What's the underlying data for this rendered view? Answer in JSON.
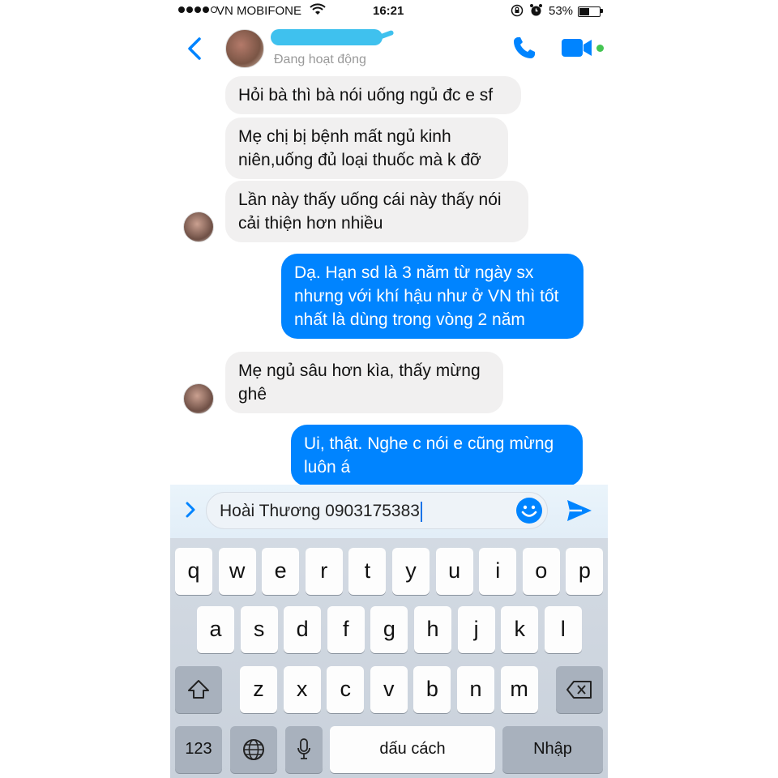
{
  "status_bar": {
    "carrier": "VN MOBIFONE",
    "time": "16:21",
    "battery_percent": "53%",
    "battery_level": 0.53,
    "signal_bars_filled": 4,
    "signal_bars_total": 5
  },
  "header": {
    "active_status": "Đang hoạt động",
    "name_obscured": true,
    "accent_color": "#0084ff"
  },
  "messages": [
    {
      "direction": "in",
      "text_lines": [
        "Hỏi bà thì bà nói uống ngủ đc e sf"
      ]
    },
    {
      "direction": "in",
      "text_lines": [
        "Mẹ chị bị bệnh mất ngủ kinh",
        "niên,uống đủ loại thuốc mà k đỡ"
      ]
    },
    {
      "direction": "in",
      "text_lines": [
        "Lần này thấy uống cái này thấy nói",
        "cải thiện hơn nhiều"
      ],
      "show_avatar": true
    },
    {
      "direction": "out",
      "text_lines": [
        "Dạ. Hạn sd là 3 năm từ ngày sx",
        "nhưng với khí hậu như ở VN thì tốt",
        "nhất là dùng trong vòng 2 năm"
      ]
    },
    {
      "direction": "in",
      "text_lines": [
        "Mẹ ngủ sâu hơn kìa, thấy mừng",
        "ghê"
      ],
      "show_avatar": true
    },
    {
      "direction": "out",
      "text_lines": [
        "Ui, thật. Nghe c nói e cũng mừng",
        "luôn á"
      ]
    }
  ],
  "composer": {
    "input_value": "Hoài Thương 0903175383"
  },
  "keyboard": {
    "row1": [
      "q",
      "w",
      "e",
      "r",
      "t",
      "y",
      "u",
      "i",
      "o",
      "p"
    ],
    "row2": [
      "a",
      "s",
      "d",
      "f",
      "g",
      "h",
      "j",
      "k",
      "l"
    ],
    "row3": [
      "z",
      "x",
      "c",
      "v",
      "b",
      "n",
      "m"
    ],
    "numbers_label": "123",
    "space_label": "dấu cách",
    "return_label": "Nhập"
  }
}
